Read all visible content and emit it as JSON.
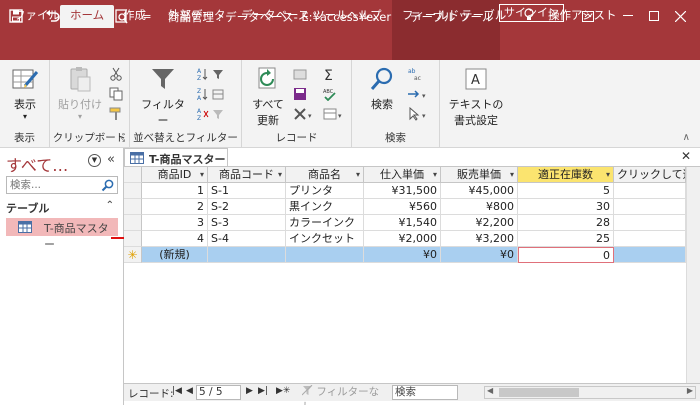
{
  "titlebar": {
    "title": "商品管理 : データベース- E:¥access¥exer…",
    "context_tab": "テーブル ツール",
    "signin": "サインイン",
    "quick_access_mark": "="
  },
  "ribbon_tabs": [
    "ファイル",
    "ホーム",
    "作成",
    "外部データ",
    "データベース ツール",
    "ヘルプ",
    "フィールド",
    "テーブル"
  ],
  "tell_me": "操作アシスト",
  "ribbon": {
    "view": {
      "button": "表示",
      "group": "表示"
    },
    "clipboard": {
      "paste": "貼り付け",
      "group": "クリップボード"
    },
    "sort_filter": {
      "filter": "フィルター",
      "group": "並べ替えとフィルター"
    },
    "records": {
      "refresh_1": "すべて",
      "refresh_2": "更新",
      "group": "レコード"
    },
    "find": {
      "find": "検索",
      "group": "検索"
    },
    "text_format": {
      "line1": "テキストの",
      "line2": "書式設定"
    }
  },
  "nav": {
    "title": "すべて…",
    "search_placeholder": "検索...",
    "group": "テーブル",
    "items": [
      "T-商品マスター"
    ]
  },
  "document": {
    "tab": "T-商品マスター",
    "columns": [
      "商品ID",
      "商品コード",
      "商品名",
      "仕入単価",
      "販売単価",
      "適正在庫数",
      "クリックして追"
    ],
    "rows": [
      [
        "1",
        "S-1",
        "プリンタ",
        "¥31,500",
        "¥45,000",
        "5"
      ],
      [
        "2",
        "S-2",
        "黒インク",
        "¥560",
        "¥800",
        "30"
      ],
      [
        "3",
        "S-3",
        "カラーインク",
        "¥1,540",
        "¥2,200",
        "28"
      ],
      [
        "4",
        "S-4",
        "インクセット",
        "¥2,000",
        "¥3,200",
        "25"
      ]
    ],
    "new_row": [
      "(新規)",
      "",
      "",
      "¥0",
      "¥0",
      "0"
    ]
  },
  "record_nav": {
    "label": "レコード:",
    "position": "5 / 5",
    "filter": "フィルターなし",
    "search": "検索"
  },
  "colors": {
    "brand": "#a4373a",
    "context_tab": "#8b2c2f",
    "selected_column": "#fbe46f",
    "new_row": "#a9cff0",
    "nav_selected": "#f2b8b9"
  }
}
